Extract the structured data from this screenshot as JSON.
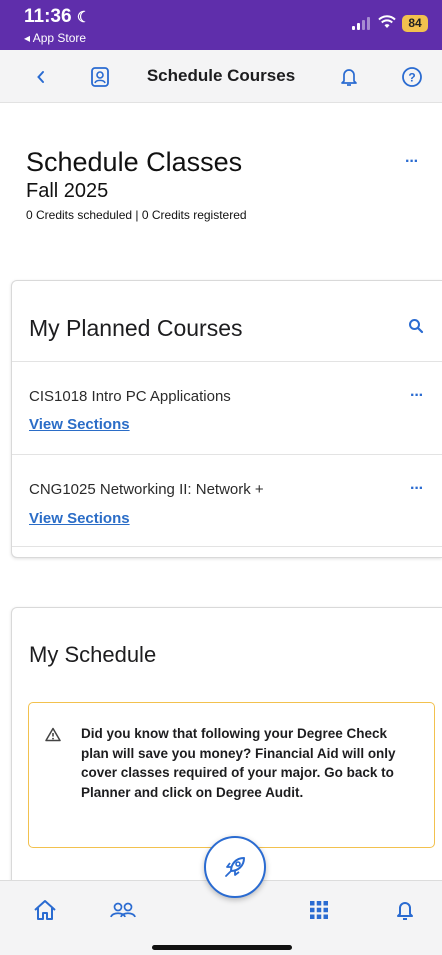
{
  "status_bar": {
    "time": "11:36",
    "back_app": "◂ App Store",
    "battery": "84"
  },
  "header": {
    "title": "Schedule Courses",
    "icons": [
      "back-chevron-icon",
      "profile-icon",
      "bell-icon",
      "help-icon"
    ]
  },
  "schedule": {
    "title": "Schedule Classes",
    "term": "Fall 2025",
    "credits": "0 Credits scheduled | 0 Credits registered",
    "menu_label": "···"
  },
  "planned": {
    "title": "My Planned Courses",
    "courses": [
      {
        "name": "CIS1018 Intro PC Applications",
        "link": "View Sections",
        "menu": "···"
      },
      {
        "name": "CNG1025 Networking II: Network +",
        "link": "View Sections",
        "menu": "···"
      }
    ]
  },
  "my_schedule": {
    "title": "My Schedule",
    "alert": "Did you know that following your Degree Check plan will save you money? Financial Aid will only cover classes required of your major. Go back to Planner and click on Degree Audit."
  },
  "colors": {
    "status_bar": "#5f2eab",
    "accent": "#2a6bd1",
    "alert_border": "#f2c14e"
  },
  "bottom_nav": [
    "home-icon",
    "people-icon",
    "rocket-icon",
    "grid-icon",
    "bell-icon"
  ]
}
